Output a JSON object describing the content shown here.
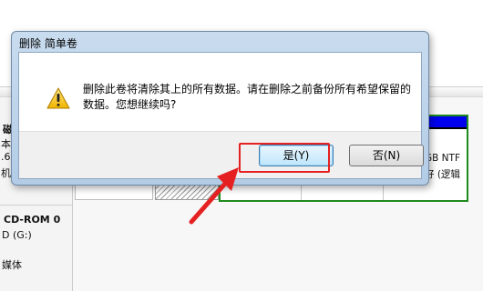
{
  "dialog": {
    "title": "删除 简单卷",
    "message": "删除此卷将清除其上的所有数据。请在删除之前备份所有希望保留的数据。您想继续吗?",
    "yes_label": "是(Y)",
    "no_label": "否(N)"
  },
  "background": {
    "disk_fragment_1": "磁",
    "disk_fragment_2": "本",
    "disk_fragment_3": ".61",
    "disk_fragment_4": "机",
    "cdrom_label": "CD-ROM 0",
    "cdrom_drive": "D (G:)",
    "cdrom_media": "媒体",
    "volume_size": "GB NTF",
    "volume_status": "好 (逻辑"
  },
  "annotation": {
    "highlight_color": "#e52020",
    "arrow_color": "#e52020"
  }
}
